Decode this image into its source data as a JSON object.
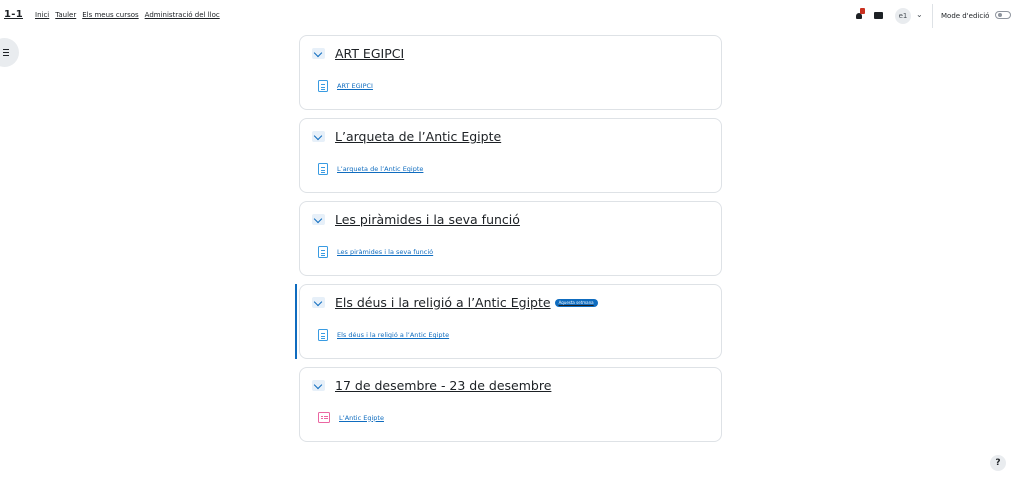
{
  "navbar": {
    "brand": "1-1",
    "links": [
      "Inici",
      "Tauler",
      "Els meus cursos",
      "Administració del lloc"
    ],
    "avatar_initials": "e1",
    "avatar_caret": "⌄",
    "edit_mode_label": "Mode d'edició",
    "edit_mode_on": false,
    "notification_badge_color": "#ca3120"
  },
  "help_label": "?",
  "accent_color": "#0f6cbf",
  "sections": [
    {
      "title": "ART EGIPCI",
      "current": false,
      "activity": {
        "type": "page",
        "icon": "page-icon",
        "label": "ART EGIPCI"
      }
    },
    {
      "title": "L’arqueta de l’Antic Egipte",
      "current": false,
      "activity": {
        "type": "page",
        "icon": "page-icon",
        "label": "L’arqueta de l’Antic Egipte"
      }
    },
    {
      "title": "Les piràmides i la seva funció",
      "current": false,
      "activity": {
        "type": "page",
        "icon": "page-icon",
        "label": "Les piràmides i la seva funció"
      }
    },
    {
      "title": "Els déus i la religió a l’Antic Egipte",
      "current": true,
      "badge": "Aquesta setmana",
      "activity": {
        "type": "page",
        "icon": "page-icon",
        "label": "Els déus i la religió a l’Antic Egipte"
      }
    },
    {
      "title": "17 de desembre - 23 de desembre",
      "current": false,
      "activity": {
        "type": "forum",
        "icon": "forum-icon",
        "label": "L’Antic Egipte"
      }
    }
  ]
}
